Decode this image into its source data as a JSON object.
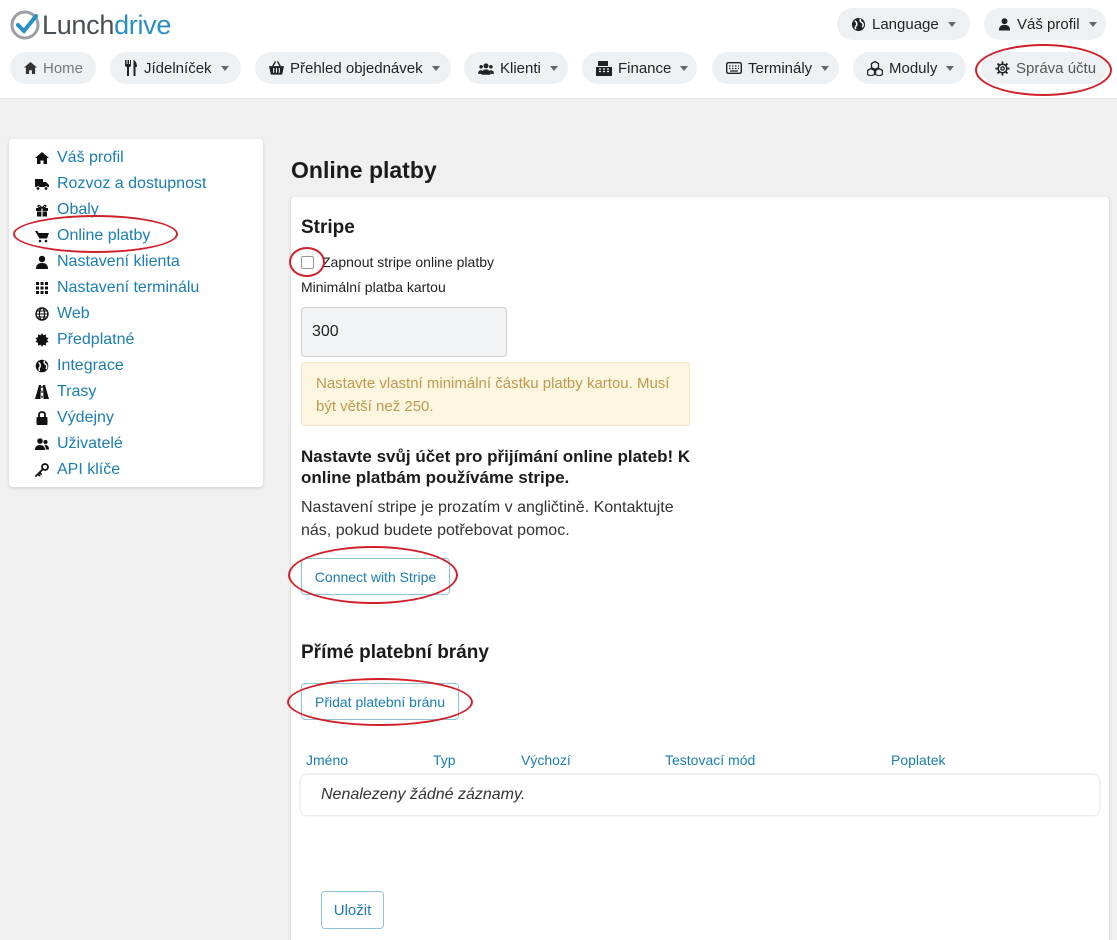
{
  "app": {
    "logo_part1": "Lunch",
    "logo_part2": "drive"
  },
  "header": {
    "language_label": "Language",
    "profile_label": "Váš profil"
  },
  "nav": {
    "home": "Home",
    "menu": "Jídelníček",
    "orders": "Přehled objednávek",
    "clients": "Klienti",
    "finance": "Finance",
    "terminals": "Terminály",
    "modules": "Moduly",
    "account": "Správa účtu"
  },
  "sidebar": {
    "items": [
      {
        "label": "Váš profil",
        "icon": "home-icon"
      },
      {
        "label": "Rozvoz a dostupnost",
        "icon": "truck-icon"
      },
      {
        "label": "Obaly",
        "icon": "gift-icon"
      },
      {
        "label": "Online platby",
        "icon": "cart-icon"
      },
      {
        "label": "Nastavení klienta",
        "icon": "user-icon"
      },
      {
        "label": "Nastavení terminálu",
        "icon": "grid-icon"
      },
      {
        "label": "Web",
        "icon": "globe-icon"
      },
      {
        "label": "Předplatné",
        "icon": "badge-icon"
      },
      {
        "label": "Integrace",
        "icon": "earth-icon"
      },
      {
        "label": "Trasy",
        "icon": "road-icon"
      },
      {
        "label": "Výdejny",
        "icon": "lock-icon"
      },
      {
        "label": "Uživatelé",
        "icon": "users-icon"
      },
      {
        "label": "API klíče",
        "icon": "key-icon"
      }
    ]
  },
  "main": {
    "title": "Online platby",
    "stripe": {
      "heading": "Stripe",
      "checkbox_label": "Zapnout stripe online platby",
      "min_label": "Minimální platba kartou",
      "min_value": "300",
      "warning": "Nastavte vlastní minimální částku platby kartou. Musí být větší než 250.",
      "setup_heading": "Nastavte svůj účet pro přijímání online plateb! K online platbám používáme stripe.",
      "setup_text": "Nastavení stripe je prozatím v angličtině. Kontaktujte nás, pokud budete potřebovat pomoc.",
      "connect_button": "Connect with Stripe"
    },
    "gateways": {
      "heading": "Přímé platební brány",
      "add_button": "Přidat platební bránu",
      "columns": [
        "Jméno",
        "Typ",
        "Výchozí",
        "Testovací mód",
        "Poplatek"
      ],
      "empty_text": "Nenalezeny žádné záznamy."
    },
    "save_button": "Uložit"
  },
  "colors": {
    "link": "#1a7db3",
    "annotation": "#d0202a",
    "warning_bg": "#fcf5e0",
    "warning_text": "#bf9a4e"
  }
}
